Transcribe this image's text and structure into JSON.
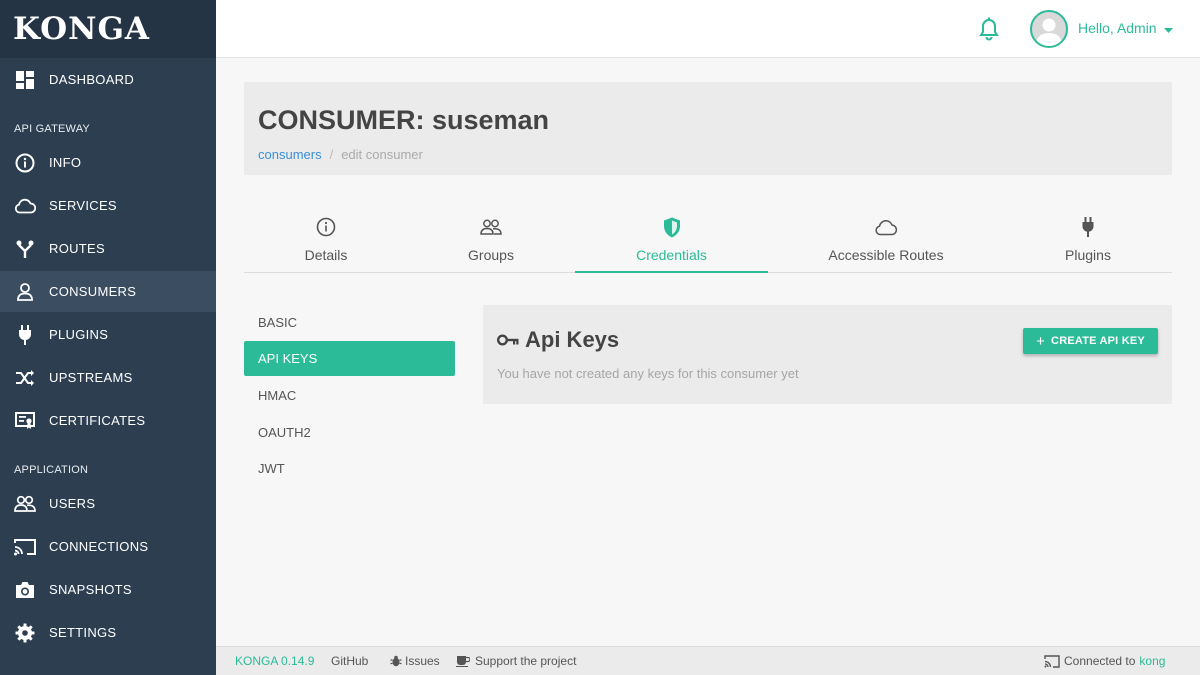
{
  "brand": "KONGA",
  "sidebar": {
    "dashboard": "DASHBOARD",
    "section_gateway": "API GATEWAY",
    "section_application": "APPLICATION",
    "items": [
      {
        "label": "INFO",
        "icon": "info-icon"
      },
      {
        "label": "SERVICES",
        "icon": "cloud-icon"
      },
      {
        "label": "ROUTES",
        "icon": "routes-icon"
      },
      {
        "label": "CONSUMERS",
        "icon": "user-icon"
      },
      {
        "label": "PLUGINS",
        "icon": "plug-icon"
      },
      {
        "label": "UPSTREAMS",
        "icon": "shuffle-icon"
      },
      {
        "label": "CERTIFICATES",
        "icon": "certificate-icon"
      },
      {
        "label": "USERS",
        "icon": "users-icon"
      },
      {
        "label": "CONNECTIONS",
        "icon": "cast-icon"
      },
      {
        "label": "SNAPSHOTS",
        "icon": "camera-icon"
      },
      {
        "label": "SETTINGS",
        "icon": "gear-icon"
      }
    ]
  },
  "header": {
    "greeting": "Hello, Admin"
  },
  "page": {
    "title": "CONSUMER: suseman",
    "breadcrumb_link": "consumers",
    "breadcrumb_sep": "/",
    "breadcrumb_current": "edit consumer"
  },
  "tabs": [
    {
      "label": "Details",
      "icon": "info-icon"
    },
    {
      "label": "Groups",
      "icon": "users-icon"
    },
    {
      "label": "Credentials",
      "icon": "shield-icon"
    },
    {
      "label": "Accessible Routes",
      "icon": "cloud-icon"
    },
    {
      "label": "Plugins",
      "icon": "plug-icon"
    }
  ],
  "credentials_nav": [
    "BASIC",
    "API KEYS",
    "HMAC",
    "OAUTH2",
    "JWT"
  ],
  "panel": {
    "title": "Api Keys",
    "empty_text": "You have not created any keys for this consumer yet",
    "create_label": "CREATE API KEY"
  },
  "footer": {
    "version": "KONGA 0.14.9",
    "github": "GitHub",
    "issues": "Issues",
    "support": "Support the project",
    "connected": "Connected to",
    "kong": "kong"
  },
  "colors": {
    "accent": "#2bbb99",
    "sidebar": "#2c3e50",
    "link": "#3a8fd8"
  }
}
